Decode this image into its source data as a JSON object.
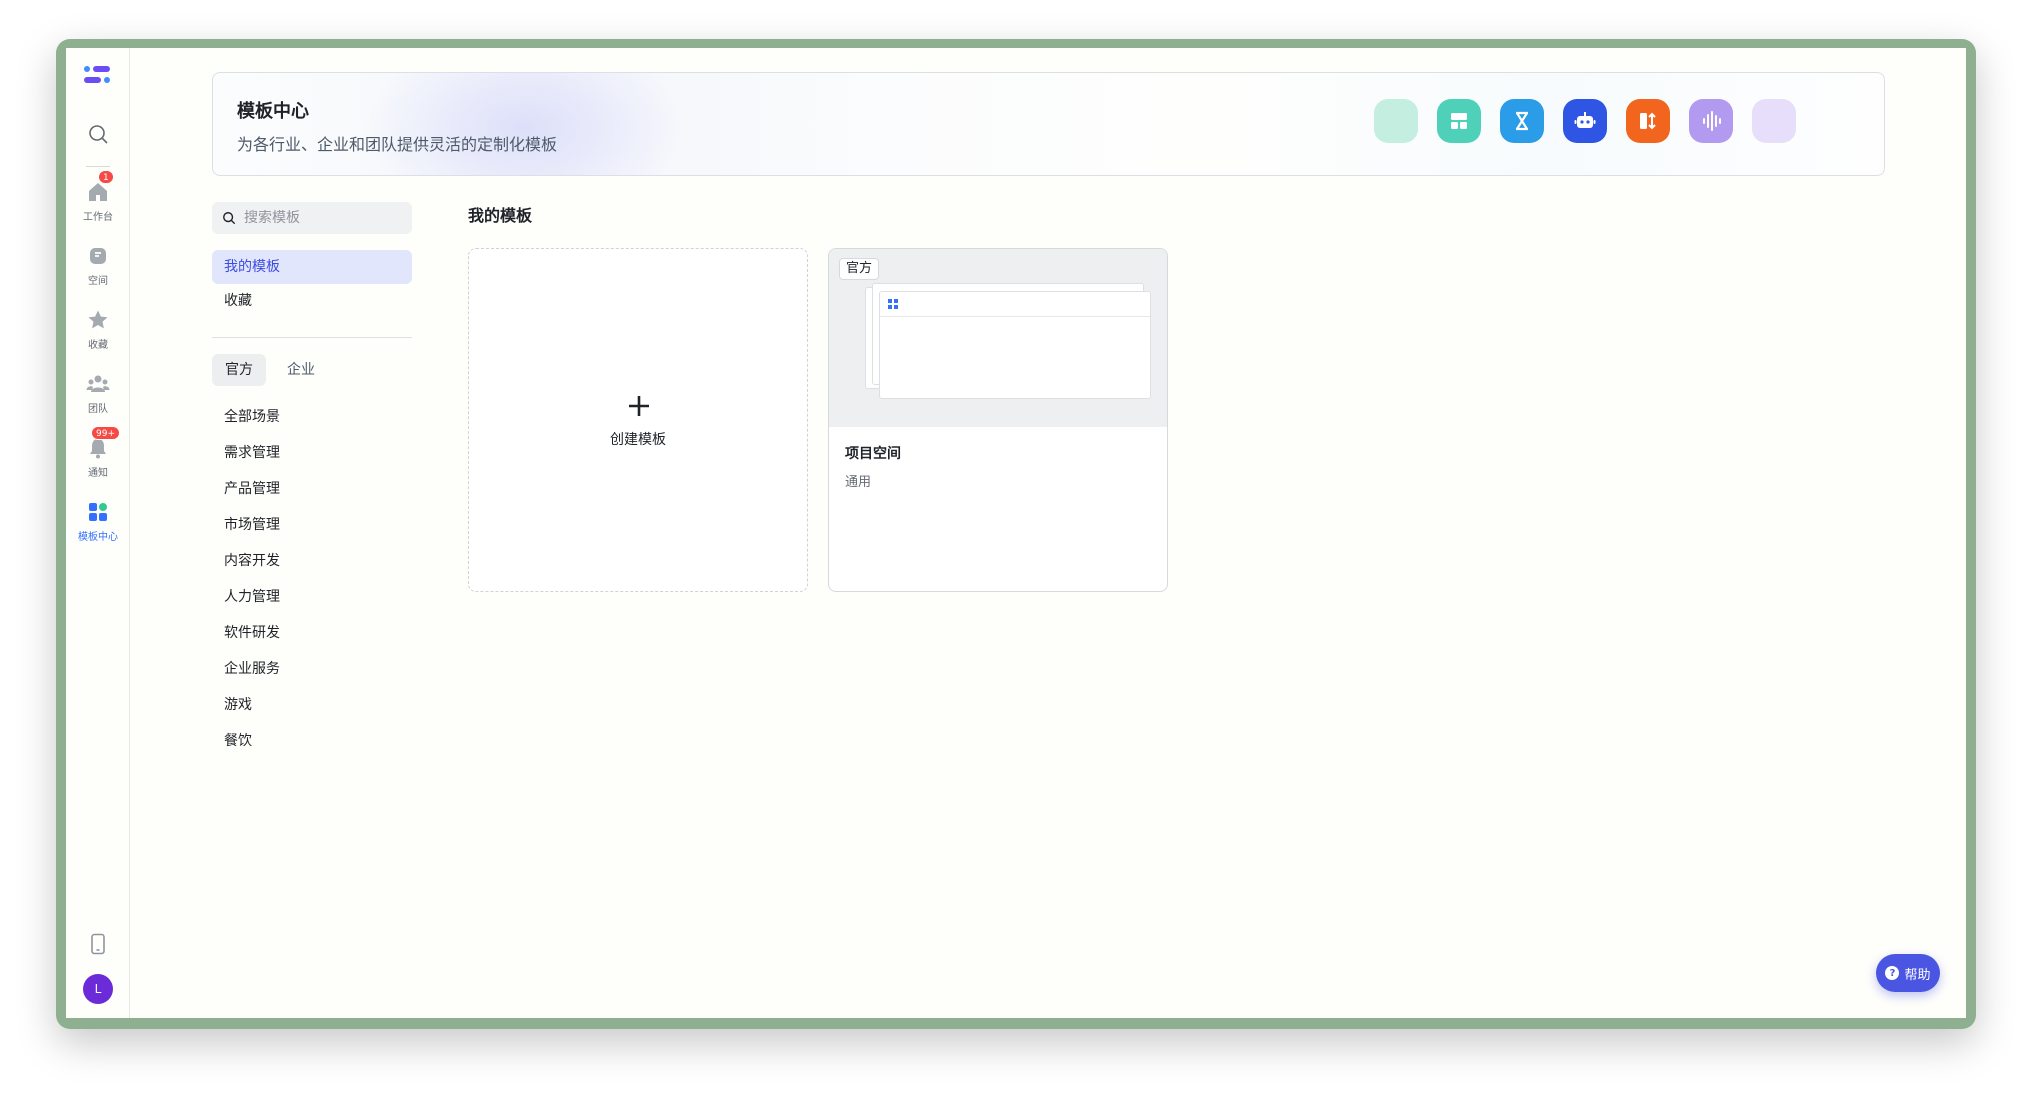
{
  "rail": {
    "items": [
      {
        "label": "工作台",
        "badge": "1"
      },
      {
        "label": "空间"
      },
      {
        "label": "收藏"
      },
      {
        "label": "团队"
      },
      {
        "label": "通知",
        "badge": "99+"
      },
      {
        "label": "模板中心",
        "active": true
      }
    ],
    "avatar": "L"
  },
  "banner": {
    "title": "模板中心",
    "subtitle": "为各行业、企业和团队提供灵活的定制化模板",
    "app_icons": [
      {
        "name": "mint-blank-icon",
        "color": "#bdeede"
      },
      {
        "name": "layout-icon",
        "color": "#4fd1b9"
      },
      {
        "name": "hourglass-icon",
        "color": "#2b9ce8"
      },
      {
        "name": "robot-icon",
        "color": "#2f55e4"
      },
      {
        "name": "split-swap-icon",
        "color": "#f2651e"
      },
      {
        "name": "audio-wave-icon",
        "color": "#b19af0"
      },
      {
        "name": "lavender-blank-icon",
        "color": "#e4dcfb"
      }
    ]
  },
  "sidebar": {
    "search_placeholder": "搜索模板",
    "nav": [
      {
        "label": "我的模板",
        "active": true
      },
      {
        "label": "收藏"
      }
    ],
    "segments": [
      {
        "label": "官方",
        "active": true
      },
      {
        "label": "企业"
      }
    ],
    "categories": [
      "全部场景",
      "需求管理",
      "产品管理",
      "市场管理",
      "内容开发",
      "人力管理",
      "软件研发",
      "企业服务",
      "游戏",
      "餐饮"
    ]
  },
  "main": {
    "section_title": "我的模板",
    "create_label": "创建模板",
    "template": {
      "tag": "官方",
      "name": "项目空间",
      "meta": "通用"
    }
  },
  "help": {
    "label": "帮助"
  },
  "colors": {
    "accent": "#3370ff",
    "brand": "#4a56e2",
    "badge": "#f54a45"
  }
}
